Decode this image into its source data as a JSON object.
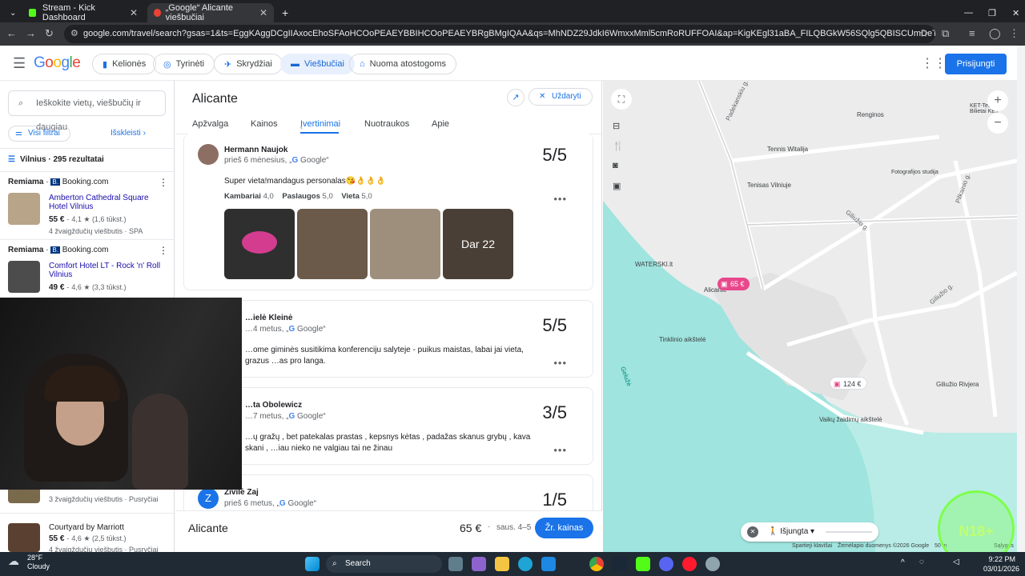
{
  "browser": {
    "tabs": [
      {
        "title": "Stream - Kick Dashboard",
        "active": false
      },
      {
        "title": "„Google“ Alicante viešbučiai",
        "active": true
      }
    ],
    "url": "google.com/travel/search?gsas=1&ts=EggKAggDCgIIAxocEhoSFAoHCOoPEAEYBBIHCOoPEAEYBRgBMgIQAA&qs=MhNDZ29JdkI6WmxxMml5cmRoRUFFOAI&ap=KigKEgl31aBA_FILQBGkW56SQlg5QBISCUmDeTSvWktAEaRbnuZkKjlAugEHc..."
  },
  "header": {
    "logo": "Google",
    "nav": [
      {
        "label": "Kelionės",
        "icon": "suitcase-icon",
        "active": false
      },
      {
        "label": "Tyrinėti",
        "icon": "explore-icon",
        "active": false
      },
      {
        "label": "Skrydžiai",
        "icon": "plane-icon",
        "active": false
      },
      {
        "label": "Viešbučiai",
        "icon": "bed-icon",
        "active": true
      },
      {
        "label": "Nuoma atostogoms",
        "icon": "house-icon",
        "active": false
      }
    ],
    "signin": "Prisijungti"
  },
  "left": {
    "search_placeholder": "Ieškokite vietų, viešbučių ir daugiau",
    "filters": "Visi filtrai",
    "expand": "Išskleisti",
    "location": "Vilnius · 295 rezultatai",
    "listings": [
      {
        "sponsored": "Remiama",
        "provider": "Booking.com",
        "name": "Amberton Cathedral Square Hotel Vilnius",
        "price": "55 €",
        "rating": "4,1 ★ (1,6 tūkst.)",
        "info": "4 žvaigždučių viešbutis · SPA"
      },
      {
        "sponsored": "Remiama",
        "provider": "Booking.com",
        "name": "Comfort Hotel LT - Rock 'n' Roll Vilnius",
        "price": "49 €",
        "rating": "4,6 ★ (3,3 tūkst.)",
        "info": ""
      },
      {
        "sponsored": "",
        "provider": "",
        "name": "",
        "price": "",
        "rating": "",
        "info": "3 žvaigždučių viešbutis · Pusryčiai"
      },
      {
        "sponsored": "",
        "provider": "",
        "name": "Courtyard by Marriott",
        "price": "55 €",
        "rating": "4,6 ★ (2,5 tūkst.)",
        "info": "4 žvaigždučių viešbutis · Pusryčiai"
      }
    ]
  },
  "detail": {
    "title": "Alicante",
    "close": "Uždaryti",
    "tabs": [
      "Apžvalga",
      "Kainos",
      "Įvertinimai",
      "Nuotraukos",
      "Apie"
    ],
    "active_tab": "Įvertinimai",
    "reviews": [
      {
        "name": "Hermann Naujok",
        "when": "prieš 6 mėnesius, „",
        "source": "Google“",
        "score": "5/5",
        "text": "Super vieta!mandagus personalas😘👌👌👌",
        "aspects": [
          {
            "label": "Kambariai",
            "value": "4,0"
          },
          {
            "label": "Paslaugos",
            "value": "5,0"
          },
          {
            "label": "Vieta",
            "value": "5,0"
          }
        ],
        "more_photos": "Dar 22"
      },
      {
        "name": "…ielė Kleinė",
        "when": "…4 metus, „",
        "source": "Google“",
        "score": "5/5",
        "text": "…ome giminės susitikima konferenciju salyteje - puikus maistas, labai jai vieta, grazus …as pro langa."
      },
      {
        "name": "…ta Obolewicz",
        "when": "…7 metus, „",
        "source": "Google“",
        "score": "3/5",
        "text": "…ų gražų , bet patekalas prastas , kepsnys kėtas , padažas skanus grybų , kava skani , …iau nieko ne valgiau tai ne žinau"
      },
      {
        "name": "Živilė Zaj",
        "when": "prieš 6 metus, „",
        "source": "Google“",
        "score": "1/5",
        "avatar_letter": "Z"
      }
    ],
    "price_bar": {
      "name": "Alicante",
      "price": "65 €",
      "dates": "saus. 4–5",
      "button": "Žr. kainas"
    }
  },
  "map": {
    "labels": [
      "Renginos",
      "Tennis Witalija",
      "Tenisas Vilniuje",
      "Fotografijos studija",
      "Padekanskiu g.",
      "Giliužio g.",
      "Pilkainio g.",
      "WATERSKI.lt",
      "Tinklinio aikštelė",
      "Gelužė",
      "Giliužio Rivjera",
      "Vaikų žaidimų aikštelė",
      "Alicante",
      "Giliužio g.",
      "KET-Testai Bilietai KET"
    ],
    "pins": [
      {
        "price": "65 €",
        "selected": true
      },
      {
        "price": "124 €",
        "selected": false
      }
    ],
    "pedestrian_toggle": "Išjungta",
    "footer": [
      "Spartieji klavišai",
      "Žemėlapio duomenys ©2026 Google",
      "50 m",
      "Sąlygos"
    ]
  },
  "taskbar": {
    "weather_temp": "28°F",
    "weather_desc": "Cloudy",
    "search": "Search",
    "time": "9:22 PM",
    "date": "03/01/2026"
  },
  "overlay": {
    "badge": "N18+"
  }
}
